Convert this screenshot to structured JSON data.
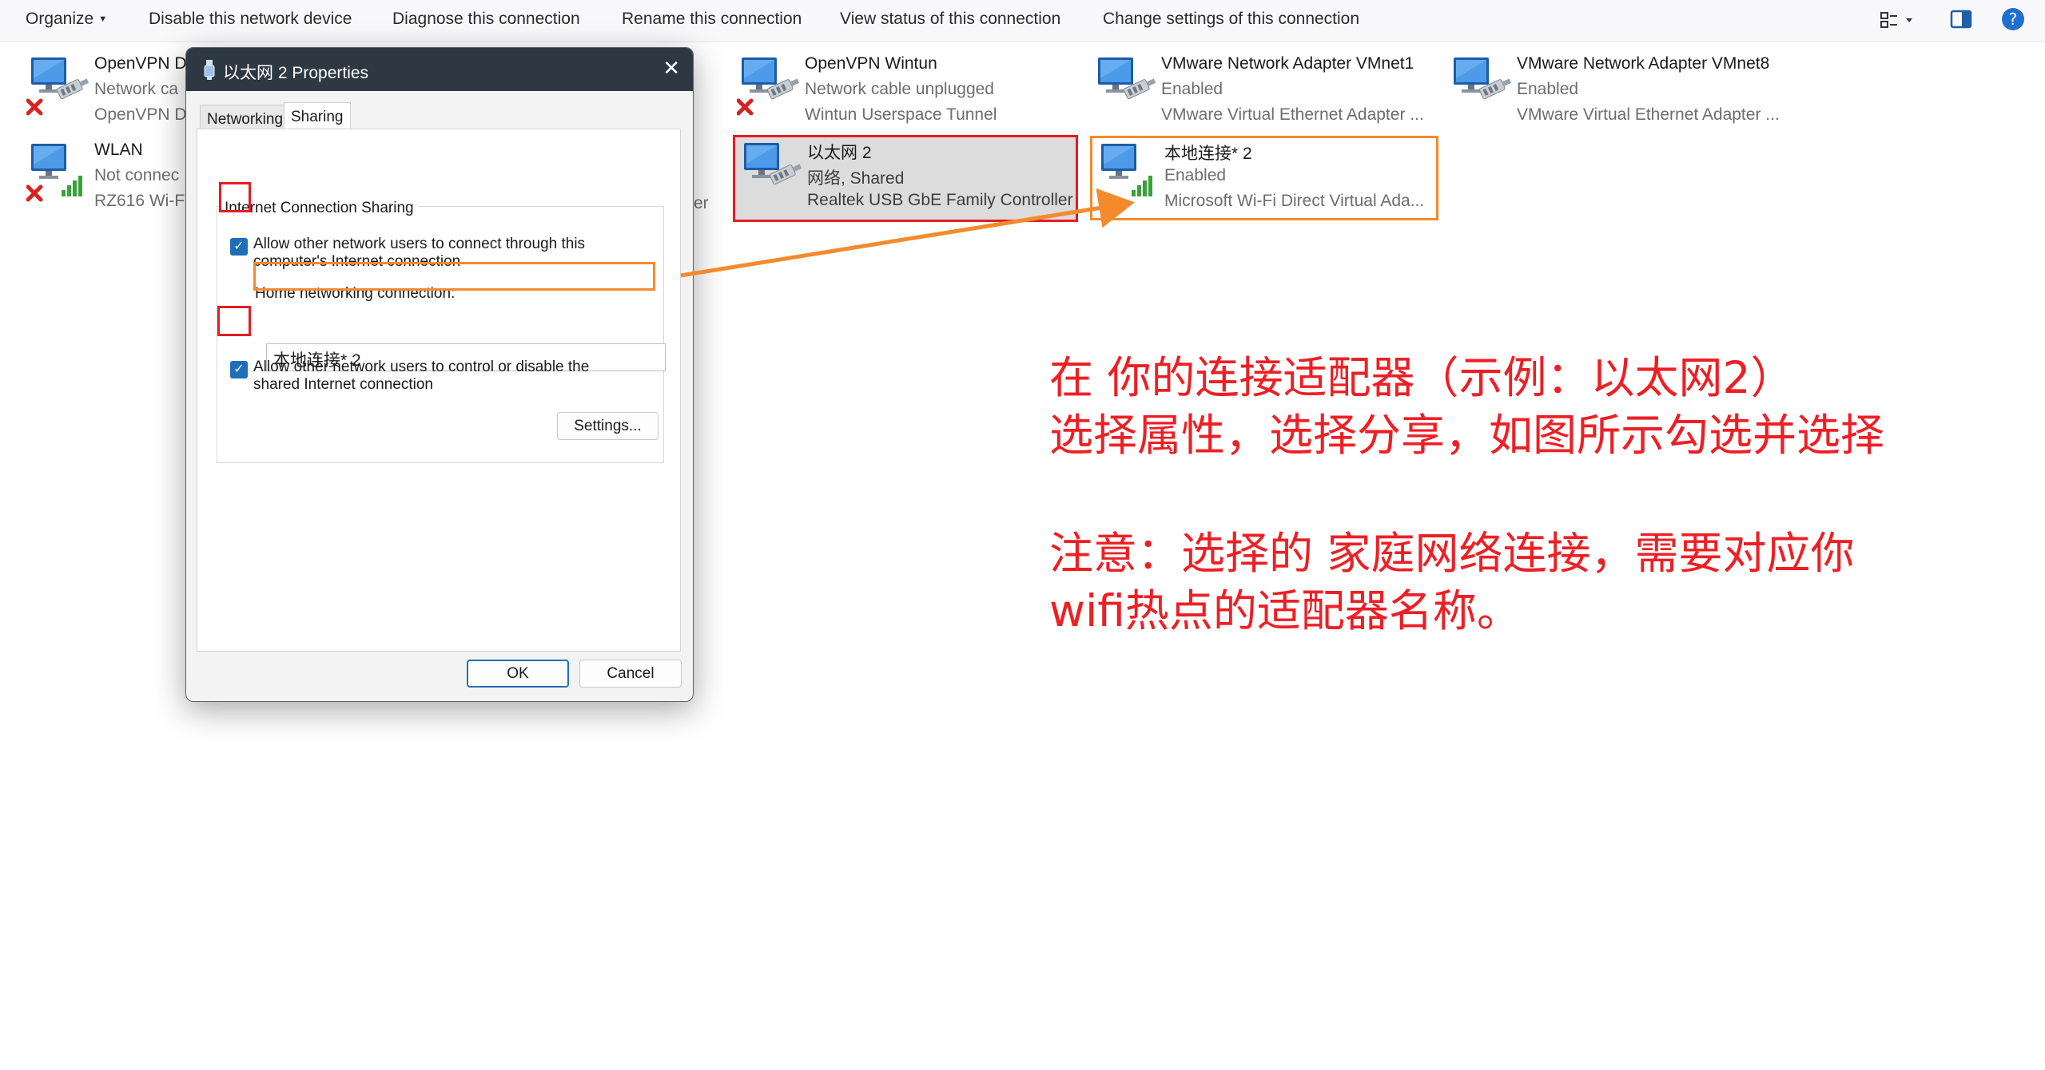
{
  "toolbar": {
    "organize": "Organize",
    "disable": "Disable this network device",
    "diagnose": "Diagnose this connection",
    "rename": "Rename this connection",
    "view_status": "View status of this connection",
    "change_settings": "Change settings of this connection"
  },
  "adapters": [
    {
      "name": "OpenVPN D",
      "status": "Network ca",
      "device": "OpenVPN D",
      "state": "disconnected"
    },
    {
      "name": "WLAN",
      "status": "Not connec",
      "device": "RZ616 Wi-F",
      "state": "wifi-disconnected"
    },
    {
      "name": "OpenVPN Wintun",
      "status": "Network cable unplugged",
      "device": "Wintun Userspace Tunnel",
      "state": "disconnected"
    },
    {
      "name": "以太网 2",
      "status": "网络, Shared",
      "device": "Realtek USB GbE Family Controller",
      "state": "selected"
    },
    {
      "name": "VMware Network Adapter VMnet1",
      "status": "Enabled",
      "device": "VMware Virtual Ethernet Adapter ...",
      "state": "enabled"
    },
    {
      "name": "本地连接* 2",
      "status": "Enabled",
      "device": "Microsoft Wi-Fi Direct Virtual Ada...",
      "state": "wifi-enabled"
    },
    {
      "name": "VMware Network Adapter VMnet8",
      "status": "Enabled",
      "device": "VMware Virtual Ethernet Adapter ...",
      "state": "enabled"
    }
  ],
  "hidden_fragment": "er",
  "dialog": {
    "title": "以太网 2 Properties",
    "tabs": [
      "Networking",
      "Sharing"
    ],
    "group_label": "Internet Connection Sharing",
    "allow_connect_line1": "Allow other network users to connect through this",
    "allow_connect_line2": "computer's Internet connection",
    "home_label": "Home networking connection:",
    "home_value": "本地连接* 2",
    "allow_control_line1": "Allow other network users to control or disable the",
    "allow_control_line2": "shared Internet connection",
    "settings_button": "Settings...",
    "ok_button": "OK",
    "cancel_button": "Cancel"
  },
  "annotation": {
    "line1": "在 你的连接适配器（示例：以太网2）",
    "line2": "选择属性，选择分享，如图所示勾选并选择",
    "line3": "注意：选择的 家庭网络连接，需要对应你",
    "line4": "wifi热点的适配器名称。"
  },
  "colors": {
    "highlight_red": "#e51c23",
    "highlight_orange": "#f58a2c",
    "annotation_red": "#ee1f24",
    "checkbox_blue": "#1f6fb8"
  }
}
